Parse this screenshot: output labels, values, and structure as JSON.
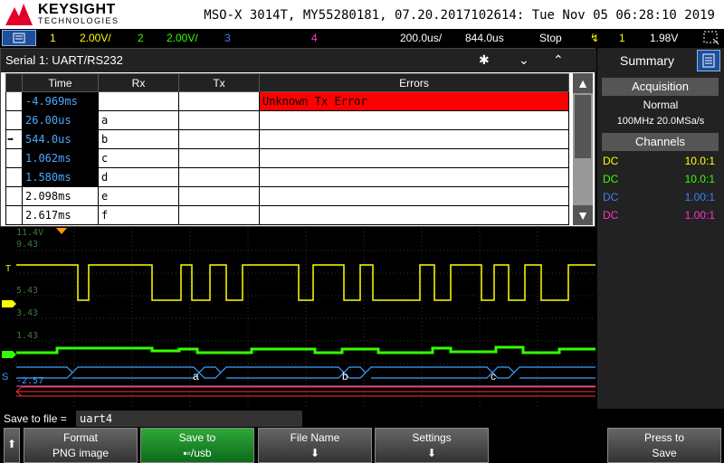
{
  "header": {
    "brand": "KEYSIGHT",
    "brand_sub": "TECHNOLOGIES",
    "model_info": "MSO-X 3014T, MY55280181, 07.20.2017102614: Tue Nov 05 06:28:10 2019"
  },
  "status_bar": {
    "ch1_num": "1",
    "ch1_scale": "2.00V/",
    "ch2_num": "2",
    "ch2_scale": "2.00V/",
    "ch3_num": "3",
    "ch4_num": "4",
    "timebase": "200.0us/",
    "delay": "844.0us",
    "run_state": "Stop",
    "trig_src": "1",
    "trig_level": "1.98V"
  },
  "serial": {
    "title": "Serial 1: UART/RS232",
    "columns": [
      "Time",
      "Rx",
      "Tx",
      "Errors"
    ],
    "rows": [
      {
        "time": "-4.969ms",
        "rx": "",
        "tx": "",
        "err": "Unknown Tx Error"
      },
      {
        "time": "26.00us",
        "rx": "a",
        "tx": "",
        "err": ""
      },
      {
        "time": "544.0us",
        "rx": "b",
        "tx": "",
        "err": ""
      },
      {
        "time": "1.062ms",
        "rx": "c",
        "tx": "",
        "err": ""
      },
      {
        "time": "1.580ms",
        "rx": "d",
        "tx": "",
        "err": ""
      },
      {
        "time": "2.098ms",
        "rx": "e",
        "tx": "",
        "err": ""
      },
      {
        "time": "2.617ms",
        "rx": "f",
        "tx": "",
        "err": ""
      }
    ]
  },
  "scope": {
    "labels": [
      "11.4V",
      "9.43",
      "5.43",
      "3.43",
      "1.43",
      "-2.57"
    ],
    "decode": [
      "a",
      "b",
      "c"
    ]
  },
  "right_panel": {
    "tab": "Summary",
    "acquisition": "Acquisition",
    "acq_mode": "Normal",
    "acq_rate": "100MHz  20.0MSa/s",
    "channels": "Channels",
    "ch_rows": [
      {
        "cpl": "DC",
        "ratio": "10.0:1",
        "color": "#ffff00"
      },
      {
        "cpl": "DC",
        "ratio": "10.0:1",
        "color": "#33ff00"
      },
      {
        "cpl": "DC",
        "ratio": "1.00:1",
        "color": "#3f7fff"
      },
      {
        "cpl": "DC",
        "ratio": "1.00:1",
        "color": "#ff33cc"
      }
    ]
  },
  "bottom": {
    "save_label": "Save to file =",
    "file_name": "uart4",
    "format_l1": "Format",
    "format_l2": "PNG image",
    "saveto_l1": "Save to",
    "saveto_l2": "/usb",
    "filename_l1": "File Name",
    "settings_l1": "Settings",
    "press_l1": "Press to",
    "press_l2": "Save"
  },
  "colors": {
    "ch1": "#ffff00",
    "ch2": "#33ff00",
    "ch3": "#3f7fff",
    "ch4": "#ff33cc",
    "serial": "#3fa0ff"
  }
}
